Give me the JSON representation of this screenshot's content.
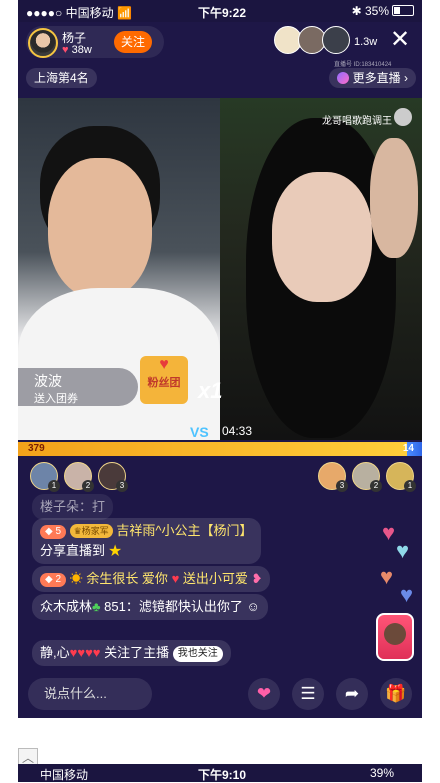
{
  "status1": {
    "carrier": "中国移动",
    "time": "下午9:22",
    "battery": "35%"
  },
  "host": {
    "name": "杨子",
    "likes": "38w",
    "follow_label": "关注"
  },
  "viewers": {
    "count": "1.3w",
    "room_id": "直播号 ID:183410424"
  },
  "rank": {
    "label": "上海第4名",
    "more_label": "更多直播"
  },
  "pk": {
    "left_name": "波波",
    "left_sub": "送入团券",
    "fan_label": "粉丝团",
    "multiplier": "x1",
    "badge": "VS",
    "timer": "04:33",
    "right_overlay": "龙哥唱歌跑调王",
    "left_score": "379",
    "right_score": "14",
    "left_share": 0.964
  },
  "supporters_left": [
    {
      "rank": "1"
    },
    {
      "rank": "2"
    },
    {
      "rank": "3"
    }
  ],
  "supporters_right": [
    {
      "rank": "3"
    },
    {
      "rank": "2"
    },
    {
      "rank": "1"
    }
  ],
  "chat": [
    {
      "user": "楼子朵：",
      "text": "打"
    },
    {
      "lvl": "5",
      "tag": "杨家军",
      "user": "吉祥雨^小公主【杨门】",
      "text": "分享直播到"
    },
    {
      "lvl": "2",
      "user": "余生很长 爱你",
      "text": "送出小可爱"
    },
    {
      "user": "众木成林",
      "text": "851：滤镜都快认出你了"
    },
    {
      "user": "静,心",
      "text": "关注了主播",
      "action": "我也关注"
    }
  ],
  "input": {
    "placeholder": "说点什么..."
  },
  "status2": {
    "carrier": "中国移动",
    "time": "下午9:10",
    "battery": "39%"
  },
  "colors": {
    "bg": "#1e1747",
    "follow": "#ff6a00",
    "pk_left": "#f3a21a",
    "pk_right": "#2f66e8"
  }
}
